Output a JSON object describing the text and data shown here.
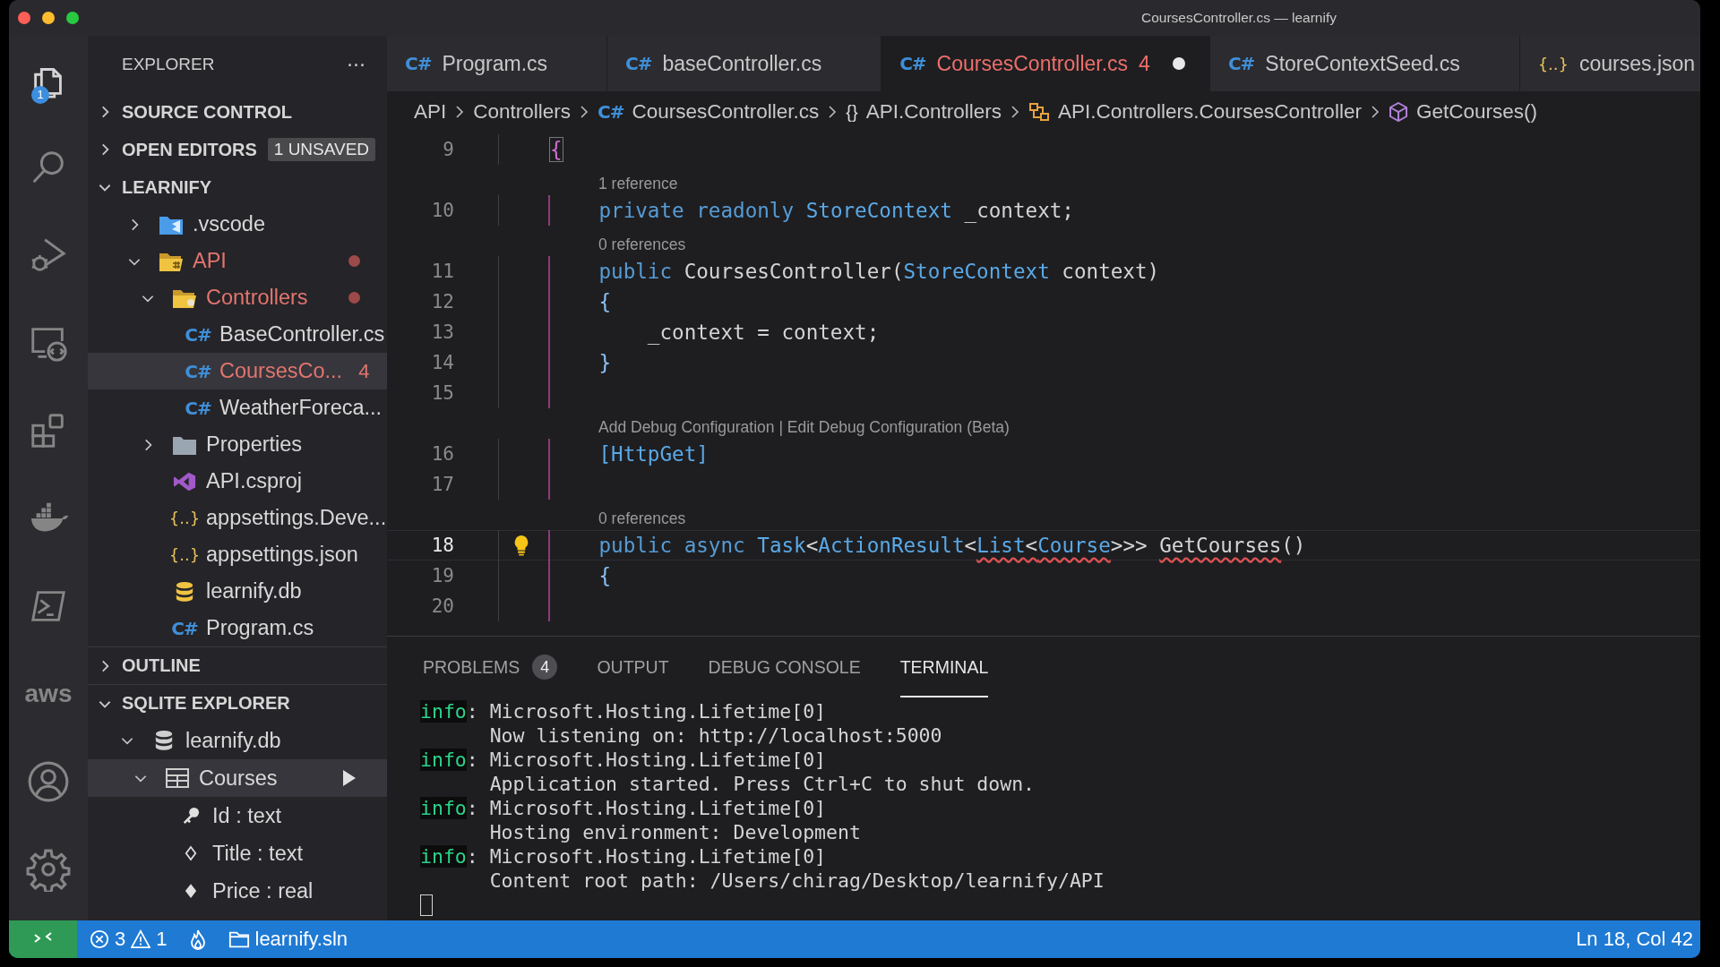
{
  "window": {
    "title": "CoursesController.cs — learnify"
  },
  "activity_bar": [
    {
      "kind": "files",
      "selected": true,
      "badge": "1"
    },
    {
      "kind": "search",
      "selected": false
    },
    {
      "kind": "debug",
      "selected": false
    },
    {
      "kind": "remote",
      "selected": false
    },
    {
      "kind": "extensions",
      "selected": false
    },
    {
      "kind": "docker",
      "selected": false
    },
    {
      "kind": "terminal",
      "selected": false
    },
    {
      "kind": "aws",
      "selected": false,
      "label": "aws"
    },
    {
      "kind": "account",
      "selected": false
    },
    {
      "kind": "settings",
      "selected": false
    }
  ],
  "sidebar": {
    "title": "EXPLORER",
    "more": "···",
    "sections": [
      {
        "title": "SOURCE CONTROL",
        "expanded": false
      },
      {
        "title": "OPEN EDITORS",
        "expanded": false,
        "badge": "1 UNSAVED"
      },
      {
        "title": "LEARNIFY",
        "expanded": true,
        "kind": "files",
        "tree": [
          {
            "label": ".vscode",
            "kind": "folder-vscode",
            "expanded": false,
            "modified": false,
            "selected": false
          },
          {
            "label": "API",
            "kind": "folder-api",
            "expanded": true,
            "modified": true,
            "selected": false,
            "children": [
              {
                "label": "Controllers",
                "kind": "folder-controllers",
                "expanded": true,
                "modified": true,
                "selected": false,
                "children": [
                  {
                    "label": "BaseController.cs",
                    "kind": "csharp",
                    "icon": "C#",
                    "modified": false,
                    "selected": false
                  },
                  {
                    "label": "CoursesCo...",
                    "kind": "csharp",
                    "icon": "C#",
                    "modified": true,
                    "selected": true,
                    "badge": "4"
                  },
                  {
                    "label": "WeatherForeca...",
                    "kind": "csharp",
                    "icon": "C#",
                    "modified": false,
                    "selected": false
                  }
                ]
              },
              {
                "label": "Properties",
                "kind": "folder",
                "expanded": false,
                "modified": false,
                "selected": false
              },
              {
                "label": "API.csproj",
                "kind": "csproj",
                "modified": false,
                "selected": false
              },
              {
                "label": "appsettings.Deve...",
                "kind": "json",
                "icon": "{..}",
                "modified": false,
                "selected": false
              },
              {
                "label": "appsettings.json",
                "kind": "json",
                "icon": "{..}",
                "modified": false,
                "selected": false
              },
              {
                "label": "learnify.db",
                "kind": "database",
                "modified": false,
                "selected": false
              },
              {
                "label": "Program.cs",
                "kind": "csharp",
                "icon": "C#",
                "modified": false,
                "selected": false
              }
            ]
          }
        ]
      },
      {
        "title": "OUTLINE",
        "expanded": false
      },
      {
        "title": "SQLITE EXPLORER",
        "expanded": true,
        "kind": "db",
        "tree": [
          {
            "label": "learnify.db",
            "kind": "db",
            "expanded": true,
            "selected": false,
            "children": [
              {
                "label": "Courses",
                "kind": "table",
                "expanded": true,
                "selected": true,
                "run": true,
                "children": [
                  {
                    "label": "Id : text",
                    "kind": "key",
                    "selected": false
                  },
                  {
                    "label": "Title : text",
                    "kind": "column",
                    "selected": false
                  },
                  {
                    "label": "Price : real",
                    "kind": "column-filled",
                    "selected": false
                  }
                ]
              }
            ]
          }
        ]
      }
    ]
  },
  "tabs": [
    {
      "label": "Program.cs",
      "kind": "csharp",
      "icon": "C#",
      "selected": false,
      "dirty": false
    },
    {
      "label": "baseController.cs",
      "kind": "csharp",
      "icon": "C#",
      "selected": false,
      "dirty": false
    },
    {
      "label": "CoursesController.cs",
      "kind": "csharp",
      "icon": "C#",
      "selected": true,
      "dirty": true,
      "problems": "4"
    },
    {
      "label": "StoreContextSeed.cs",
      "kind": "csharp",
      "icon": "C#",
      "selected": false,
      "dirty": false
    },
    {
      "label": "courses.json",
      "kind": "json",
      "icon": "{..}",
      "selected": false,
      "dirty": false
    }
  ],
  "breadcrumbs": [
    {
      "label": "API",
      "kind": "folder"
    },
    {
      "label": "Controllers",
      "kind": "folder"
    },
    {
      "label": "CoursesController.cs",
      "kind": "csharp",
      "icon": "C#"
    },
    {
      "label": "API.Controllers",
      "kind": "namespace",
      "icon": "{}"
    },
    {
      "label": "API.Controllers.CoursesController",
      "kind": "class"
    },
    {
      "label": "GetCourses()",
      "kind": "method"
    }
  ],
  "editor": {
    "lines": [
      {
        "kind": "code",
        "number": "9",
        "guide": false,
        "current": false,
        "lightbulb": false,
        "tokens": [
          {
            "kind": "brace-match",
            "text": "{"
          }
        ]
      },
      {
        "kind": "lens",
        "text": "1 reference"
      },
      {
        "kind": "code",
        "number": "10",
        "guide": true,
        "current": false,
        "lightbulb": false,
        "tokens": [
          {
            "kind": "kw",
            "text": "    private"
          },
          {
            "kind": "kw",
            "text": " readonly"
          },
          {
            "kind": "type",
            "text": " StoreContext"
          },
          {
            "kind": "plain",
            "text": " _context;"
          }
        ]
      },
      {
        "kind": "lens",
        "text": "0 references"
      },
      {
        "kind": "code",
        "number": "11",
        "guide": true,
        "current": false,
        "lightbulb": false,
        "tokens": [
          {
            "kind": "kw",
            "text": "    public"
          },
          {
            "kind": "plain",
            "text": " CoursesController("
          },
          {
            "kind": "type",
            "text": "StoreContext"
          },
          {
            "kind": "plain",
            "text": " context)"
          }
        ]
      },
      {
        "kind": "code",
        "number": "12",
        "guide": true,
        "current": false,
        "lightbulb": false,
        "tokens": [
          {
            "kind": "brace",
            "text": "    {"
          }
        ]
      },
      {
        "kind": "code",
        "number": "13",
        "guide": true,
        "current": false,
        "lightbulb": false,
        "tokens": [
          {
            "kind": "plain",
            "text": "        _context = context;"
          }
        ]
      },
      {
        "kind": "code",
        "number": "14",
        "guide": true,
        "current": false,
        "lightbulb": false,
        "tokens": [
          {
            "kind": "brace",
            "text": "    }"
          }
        ]
      },
      {
        "kind": "code",
        "number": "15",
        "guide": true,
        "current": false,
        "lightbulb": false
      },
      {
        "kind": "lens",
        "text": "Add Debug Configuration | Edit Debug Configuration (Beta)"
      },
      {
        "kind": "code",
        "number": "16",
        "guide": true,
        "current": false,
        "lightbulb": false,
        "tokens": [
          {
            "kind": "type",
            "text": "    [HttpGet]"
          }
        ]
      },
      {
        "kind": "code",
        "number": "17",
        "guide": true,
        "current": false,
        "lightbulb": false
      },
      {
        "kind": "lens",
        "text": "0 references"
      },
      {
        "kind": "code",
        "number": "18",
        "guide": true,
        "current": true,
        "lightbulb": true,
        "tokens": [
          {
            "kind": "kw",
            "text": "    public"
          },
          {
            "kind": "kw",
            "text": " async"
          },
          {
            "kind": "type",
            "text": " Task"
          },
          {
            "kind": "plain",
            "text": "<"
          },
          {
            "kind": "type",
            "text": "ActionResult"
          },
          {
            "kind": "plain",
            "text": "<"
          },
          {
            "kind": "type-err",
            "text": "List"
          },
          {
            "kind": "plain-err",
            "text": "<"
          },
          {
            "kind": "type-err",
            "text": "Course"
          },
          {
            "kind": "plain",
            "text": ">>> "
          },
          {
            "kind": "plain-err",
            "text": "GetCourses"
          },
          {
            "kind": "plain",
            "text": "()"
          }
        ]
      },
      {
        "kind": "code",
        "number": "19",
        "guide": true,
        "current": false,
        "lightbulb": false,
        "tokens": [
          {
            "kind": "brace",
            "text": "    {"
          }
        ]
      },
      {
        "kind": "code",
        "number": "20",
        "guide": true,
        "current": false,
        "lightbulb": false
      }
    ]
  },
  "panel": {
    "tabs": [
      {
        "label": "PROBLEMS",
        "badge": "4",
        "selected": false
      },
      {
        "label": "OUTPUT",
        "selected": false
      },
      {
        "label": "DEBUG CONSOLE",
        "selected": false
      },
      {
        "label": "TERMINAL",
        "selected": true
      }
    ],
    "terminal": [
      {
        "kind": "log",
        "level": "info",
        "text": ": Microsoft.Hosting.Lifetime[0]"
      },
      {
        "kind": "message",
        "text": "      Now listening on: http://localhost:5000"
      },
      {
        "kind": "log",
        "level": "info",
        "text": ": Microsoft.Hosting.Lifetime[0]"
      },
      {
        "kind": "message",
        "text": "      Application started. Press Ctrl+C to shut down."
      },
      {
        "kind": "log",
        "level": "info",
        "text": ": Microsoft.Hosting.Lifetime[0]"
      },
      {
        "kind": "message",
        "text": "      Hosting environment: Development"
      },
      {
        "kind": "log",
        "level": "info",
        "text": ": Microsoft.Hosting.Lifetime[0]"
      },
      {
        "kind": "message",
        "text": "      Content root path: /Users/chirag/Desktop/learnify/API"
      },
      {
        "kind": "cursor"
      }
    ]
  },
  "status_bar": {
    "errors": "3",
    "warnings": "1",
    "workspace": "learnify.sln",
    "position": "Ln 18, Col 42"
  }
}
